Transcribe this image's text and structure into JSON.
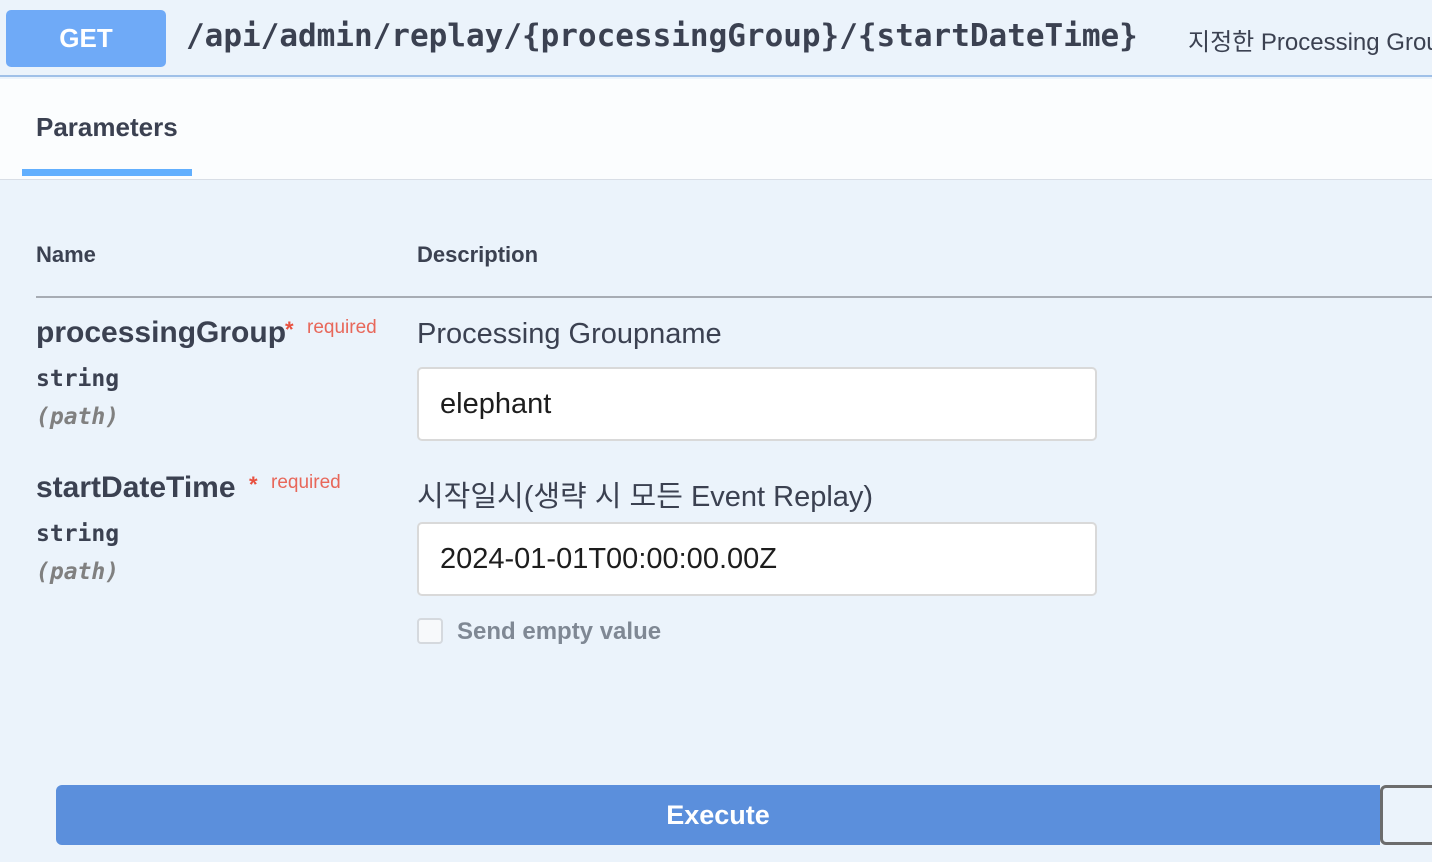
{
  "operation": {
    "method": "GET",
    "path": "/api/admin/replay/{processingGroup}/{startDateTime}",
    "summary": "지정한 Processing Grou"
  },
  "tabs": {
    "parameters_label": "Parameters"
  },
  "table": {
    "name_header": "Name",
    "description_header": "Description"
  },
  "parameters": [
    {
      "name": "processingGroup",
      "required_star": "*",
      "required_label": "required",
      "type": "string",
      "in": "(path)",
      "description": "Processing Groupname",
      "value": "elephant"
    },
    {
      "name": "startDateTime",
      "required_star": "*",
      "required_label": "required",
      "type": "string",
      "in": "(path)",
      "description": "시작일시(생략 시 모든 Event Replay)",
      "value": "2024-01-01T00:00:00.00Z"
    }
  ],
  "send_empty_value": {
    "label": "Send empty value",
    "checked": false
  },
  "actions": {
    "execute_label": "Execute"
  },
  "colors": {
    "method_get": "#6faaf7",
    "tab_active": "#61affe",
    "required": "#e85140",
    "execute": "#5b8fdc",
    "background": "#ebf3fb"
  }
}
